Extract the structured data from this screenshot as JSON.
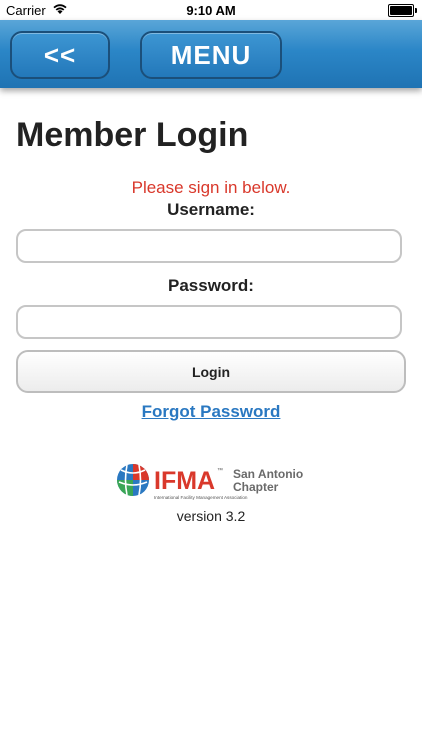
{
  "status_bar": {
    "carrier": "Carrier",
    "time": "9:10 AM"
  },
  "header": {
    "back_label": "<<",
    "menu_label": "MENU",
    "color": "#2b86c7"
  },
  "login": {
    "title": "Member Login",
    "prompt": "Please sign in below.",
    "username_label": "Username:",
    "username_value": "",
    "password_label": "Password:",
    "password_value": "",
    "login_label": "Login",
    "forgot_label": "Forgot Password",
    "prompt_color": "#d9382b",
    "link_color": "#2a78c1"
  },
  "footer": {
    "logo": {
      "acronym": "IFMA",
      "tm": "™",
      "chapter_line1": "San Antonio",
      "chapter_line2": "Chapter",
      "tagline": "International Facility Management Association",
      "accent_color": "#d9382b"
    },
    "version": "version 3.2"
  }
}
